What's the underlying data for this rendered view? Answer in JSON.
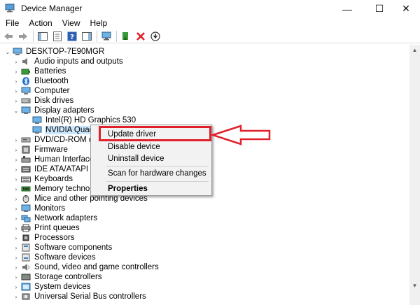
{
  "window": {
    "title": "Device Manager",
    "minimize": "—",
    "maximize": "☐",
    "close": "✕"
  },
  "menu": [
    "File",
    "Action",
    "View",
    "Help"
  ],
  "tree": {
    "root": "DESKTOP-7E90MGR",
    "items": [
      "Audio inputs and outputs",
      "Batteries",
      "Bluetooth",
      "Computer",
      "Disk drives",
      "Display adapters",
      "Intel(R) HD Graphics 530",
      "NVIDIA Quadro",
      "DVD/CD-ROM drive",
      "Firmware",
      "Human Interface De",
      "IDE ATA/ATAPI contro",
      "Keyboards",
      "Memory technolog",
      "Mice and other pointing devices",
      "Monitors",
      "Network adapters",
      "Print queues",
      "Processors",
      "Software components",
      "Software devices",
      "Sound, video and game controllers",
      "Storage controllers",
      "System devices",
      "Universal Serial Bus controllers"
    ]
  },
  "context_menu": {
    "update_driver": "Update driver",
    "disable_device": "Disable device",
    "uninstall_device": "Uninstall device",
    "scan": "Scan for hardware changes",
    "properties": "Properties"
  },
  "colors": {
    "highlight": "#e0202a",
    "selection": "#cce8ff"
  }
}
